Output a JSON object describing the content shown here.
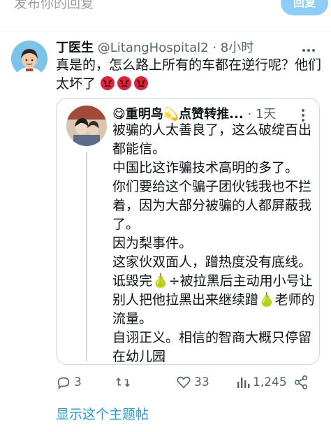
{
  "compose": {
    "placeholder": "发布你的回复",
    "reply_label": "回复"
  },
  "tweet": {
    "author_name": "丁医生",
    "handle": "@LitangHospital2",
    "time": "· 8小时",
    "text": "真是的，怎么路上所有的车都在逆行呢？他们太坏了",
    "emoji_icon": "angry-face-icon"
  },
  "quote": {
    "author_name": "😋重明鸟💫点赞转推...",
    "time": "· 1天",
    "paragraphs": [
      "被骗的人太善良了，这么破绽百出都能信。",
      "中国比这诈骗技术高明的多了。",
      "你们要给这个骗子团伙钱我也不拦着，因为大部分被骗的人都屏蔽我了。",
      "因为梨事件。",
      "这家伙双面人，蹭热度没有底线。诋毁完🍐÷被拉黑后主动用小号让别人把他拉黑出来继续蹭🍐老师的流量。",
      "自诩正义。相信的智商大概只停留在幼儿园"
    ]
  },
  "actions": {
    "reply_count": "3",
    "retweet_count": "",
    "like_count": "33",
    "view_count": "1,245"
  },
  "show_thread": "显示这个主题帖",
  "colors": {
    "accent": "#1d9bf0",
    "muted": "#536471",
    "border": "#cfd9de"
  }
}
